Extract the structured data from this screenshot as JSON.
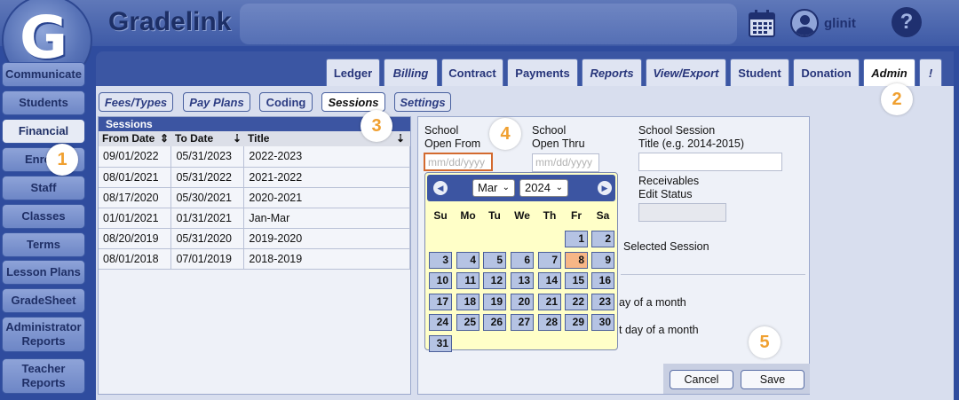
{
  "app": {
    "brand": "Gradelink",
    "logo_letter": "G",
    "username": "glinit",
    "help_label": "?"
  },
  "sidebar": {
    "items": [
      {
        "label": "Communicate"
      },
      {
        "label": "Students"
      },
      {
        "label": "Financial"
      },
      {
        "label": "Enro"
      },
      {
        "label": "Staff"
      },
      {
        "label": "Classes"
      },
      {
        "label": "Terms"
      },
      {
        "label": "Lesson Plans"
      },
      {
        "label": "GradeSheet"
      },
      {
        "label": "Administrator Reports"
      },
      {
        "label": "Teacher Reports"
      }
    ],
    "active": "Financial"
  },
  "tabs": [
    {
      "label": "Ledger"
    },
    {
      "label": "Billing"
    },
    {
      "label": "Contract"
    },
    {
      "label": "Payments"
    },
    {
      "label": "Reports"
    },
    {
      "label": "View/Export"
    },
    {
      "label": "Student"
    },
    {
      "label": "Donation"
    },
    {
      "label": "Admin"
    },
    {
      "label": "!"
    }
  ],
  "subtabs": [
    {
      "label": "Fees/Types"
    },
    {
      "label": "Pay Plans"
    },
    {
      "label": "Coding"
    },
    {
      "label": "Sessions"
    },
    {
      "label": "Settings"
    }
  ],
  "sessions": {
    "title": "Sessions",
    "columns": [
      "From Date",
      "To Date",
      "Title"
    ],
    "sort_from": "⇕",
    "sort_to": "⇣",
    "sort_title": "⇣",
    "rows": [
      [
        "09/01/2022",
        "05/31/2023",
        "2022-2023"
      ],
      [
        "08/01/2021",
        "05/31/2022",
        "2021-2022"
      ],
      [
        "08/17/2020",
        "05/30/2021",
        "2020-2021"
      ],
      [
        "01/01/2021",
        "01/31/2021",
        "Jan-Mar"
      ],
      [
        "08/20/2019",
        "05/31/2020",
        "2019-2020"
      ],
      [
        "08/01/2018",
        "07/01/2019",
        "2018-2019"
      ]
    ]
  },
  "form": {
    "open_from_label": "School\nOpen From",
    "open_from_l1": "School",
    "open_from_l2": "Open From",
    "open_thru_l1": "School",
    "open_thru_l2": "Open Thru",
    "title_l1": "School Session",
    "title_l2": "Title (e.g. 2014-2015)",
    "receivables_l1": "Receivables",
    "receivables_l2": "Edit Status",
    "date_placeholder": "mm/dd/yyyy",
    "selected_session_text": "Selected Session",
    "day_of_month_text": "ay of a month",
    "last_day_text": "t day of a month",
    "cancel_label": "Cancel",
    "save_label": "Save"
  },
  "datepicker": {
    "month": "Mar",
    "year": "2024",
    "prev": "◀",
    "next": "▶",
    "weekdays": [
      "Su",
      "Mo",
      "Tu",
      "We",
      "Th",
      "Fr",
      "Sa"
    ],
    "first_weekday_index": 5,
    "days_in_month": 31,
    "selected_day": 8
  },
  "markers": [
    "1",
    "2",
    "3",
    "4",
    "5"
  ],
  "colors": {
    "accent": "#3c55a2",
    "marker": "#f0a030",
    "today": "#f7b686"
  }
}
